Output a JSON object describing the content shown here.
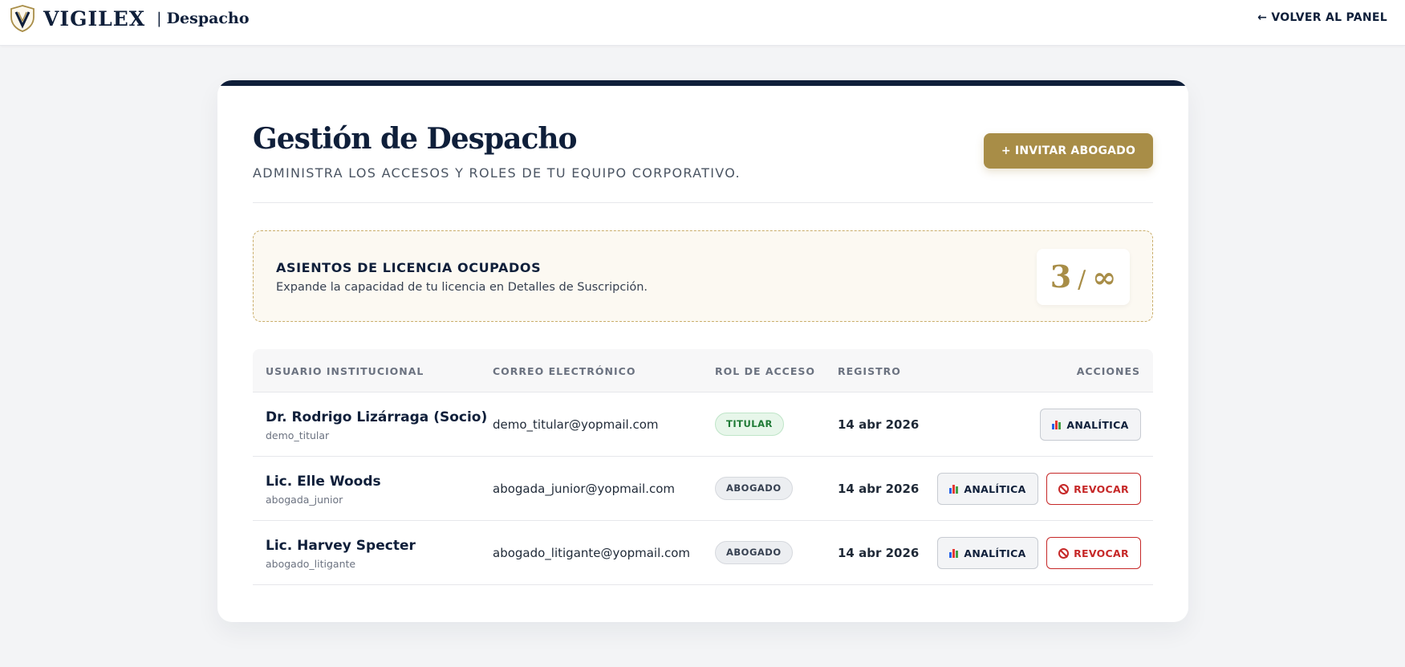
{
  "header": {
    "brand": "VIGILEX",
    "separator": "|",
    "section": "Despacho",
    "back_label": "← VOLVER AL PANEL"
  },
  "page": {
    "title": "Gestión de Despacho",
    "subtitle": "ADMINISTRA LOS ACCESOS Y ROLES DE TU EQUIPO CORPORATIVO.",
    "invite_label": "+ INVITAR ABOGADO"
  },
  "license": {
    "title": "ASIENTOS DE LICENCIA OCUPADOS",
    "description": "Expande la capacidad de tu licencia en Detalles de Suscripción.",
    "used": "3",
    "slash": "/",
    "total": "∞"
  },
  "table": {
    "headers": {
      "user": "USUARIO INSTITUCIONAL",
      "email": "CORREO ELECTRÓNICO",
      "role": "ROL DE ACCESO",
      "registered": "REGISTRO",
      "actions": "ACCIONES"
    },
    "rows": [
      {
        "name": "Dr. Rodrigo Lizárraga (Socio)",
        "handle": "demo_titular",
        "email": "demo_titular@yopmail.com",
        "role": "TITULAR",
        "registered": "14 abr 2026",
        "analytics_label": "ANALÍTICA"
      },
      {
        "name": "Lic. Elle Woods",
        "handle": "abogada_junior",
        "email": "abogada_junior@yopmail.com",
        "role": "ABOGADO",
        "registered": "14 abr 2026",
        "analytics_label": "ANALÍTICA",
        "revoke_label": "REVOCAR"
      },
      {
        "name": "Lic. Harvey Specter",
        "handle": "abogado_litigante",
        "email": "abogado_litigante@yopmail.com",
        "role": "ABOGADO",
        "registered": "14 abr 2026",
        "analytics_label": "ANALÍTICA",
        "revoke_label": "REVOCAR"
      }
    ]
  },
  "icons": {
    "logo": "shield-v-logo-icon",
    "analytics": "bar-chart-icon",
    "revoke": "prohibited-icon"
  },
  "colors": {
    "navy": "#0f1f3a",
    "gold": "#a88d47",
    "danger": "#c62828",
    "success": "#1f7a36"
  }
}
